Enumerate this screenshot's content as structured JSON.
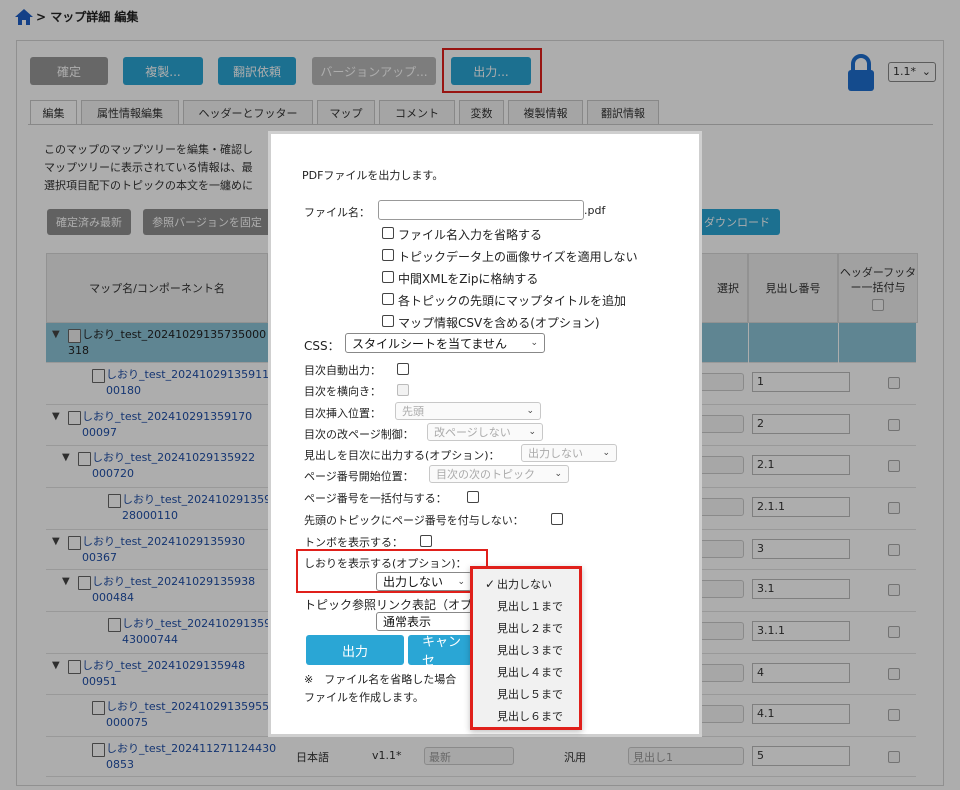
{
  "breadcrumb": {
    "separator": ">",
    "title": "マップ詳細 編集"
  },
  "toolbar": {
    "confirm": "確定",
    "duplicate": "複製...",
    "translate": "翻訳依頼",
    "version_up": "バージョンアップ...",
    "output": "出力..."
  },
  "version_select": "1.1*",
  "tabs": [
    "編集",
    "属性情報編集",
    "ヘッダーとフッター",
    "マップ",
    "コメント",
    "変数",
    "複製情報",
    "翻訳情報"
  ],
  "description": [
    "このマップのマップツリーを編集・確認し",
    "マップツリーに表示されている情報は、最",
    "選択項目配下のトピックの本文を一纏めに"
  ],
  "subtoolbar": {
    "latest": "確定済み最新",
    "pin_ref": "参照バージョンを固定",
    "download": "ダウンロード"
  },
  "table": {
    "headers": {
      "name": "マップ名/コンポーネント名",
      "select": "選択",
      "heading_number": "見出し番号",
      "header_footer": "ヘッダーフッター一括付与"
    },
    "rows": [
      {
        "line1": "しおり_test_20241029135735000",
        "line2": "318",
        "number": ""
      },
      {
        "line1": "しおり_test_202410291359110",
        "line2": "00180",
        "number": "1"
      },
      {
        "line1": "しおり_test_202410291359170",
        "line2": "00097",
        "number": "2"
      },
      {
        "line1": "しおり_test_20241029135922",
        "line2": "000720",
        "number": "2.1"
      },
      {
        "line1": "しおり_test_202410291359",
        "line2": "28000110",
        "number": "2.1.1"
      },
      {
        "line1": "しおり_test_20241029135930",
        "line2": "00367",
        "number": "3"
      },
      {
        "line1": "しおり_test_20241029135938",
        "line2": "000484",
        "number": "3.1"
      },
      {
        "line1": "しおり_test_202410291359",
        "line2": "43000744",
        "number": "3.1.1"
      },
      {
        "line1": "しおり_test_20241029135948",
        "line2": "00951",
        "number": "4"
      },
      {
        "line1": "しおり_test_20241029135955",
        "line2": "000075",
        "number": "4.1"
      },
      {
        "line1": "しおり_test_202411271124430",
        "line2": "0853",
        "number": "5"
      }
    ],
    "last_row": {
      "lang": "日本語",
      "version": "v1.1*",
      "latest": "最新",
      "general": "汎用",
      "heading": "見出し1"
    }
  },
  "dialog": {
    "intro": "PDFファイルを出力します。",
    "filename_label": "ファイル名：",
    "filename_value": "",
    "filename_ext": ".pdf",
    "checkboxes": [
      "ファイル名入力を省略する",
      "トピックデータ上の画像サイズを適用しない",
      "中間XMLをZipに格納する",
      "各トピックの先頭にマップタイトルを追加",
      "マップ情報CSVを含める(オプション)"
    ],
    "css_label": "CSS：",
    "css_value": "スタイルシートを当てません",
    "toc_auto": "目次自動出力：",
    "toc_horizontal": "目次を横向き：",
    "toc_insert_label": "目次挿入位置：",
    "toc_insert_value": "先頭",
    "toc_pagebreak_label": "目次の改ページ制御：",
    "toc_pagebreak_value": "改ページしない",
    "heading_toc_label": "見出しを目次に出力する(オプション)：",
    "heading_toc_value": "出力しない",
    "page_start_label": "ページ番号開始位置：",
    "page_start_value": "目次の次のトピック",
    "page_bulk_label": "ページ番号を一括付与する：",
    "first_topic_label": "先頭のトピックにページ番号を付与しない：",
    "trim_label": "トンボを表示する：",
    "bookmark_label": "しおりを表示する(オプション)：",
    "bookmark_value": "出力しない",
    "topic_ref_label": "トピック参照リンク表記（オプ",
    "topic_ref_value": "通常表示",
    "output_button": "出力",
    "cancel_button": "キャンセ",
    "note_line1": "※　ファイル名を省略した場合",
    "note_line2": "ファイルを作成します。"
  },
  "dropdown": {
    "options": [
      "出力しない",
      "見出し１まで",
      "見出し２まで",
      "見出し３まで",
      "見出し４まで",
      "見出し５まで",
      "見出し６まで"
    ],
    "selected_index": 0,
    "check_mark": "✓"
  },
  "colors": {
    "accent": "#2aa6d5",
    "highlight": "#e0201b",
    "row_selected": "#8cc4d8",
    "lock": "#1e6fd0"
  }
}
